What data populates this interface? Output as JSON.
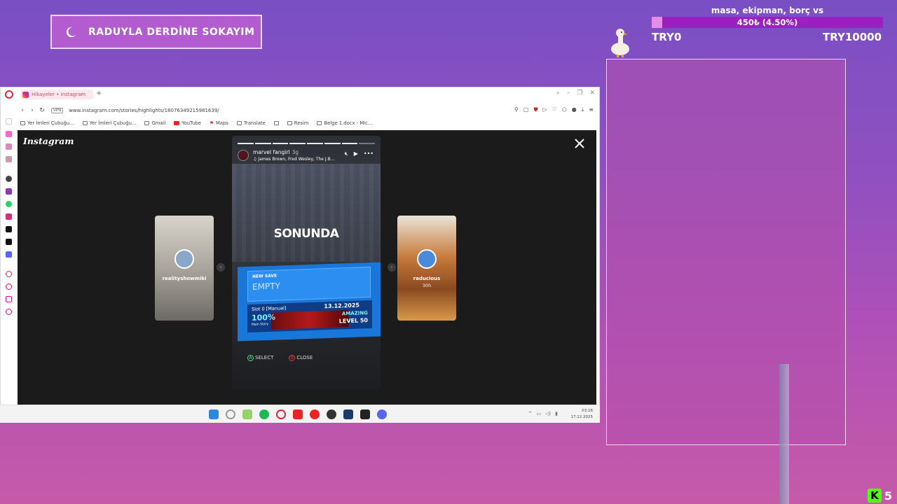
{
  "overlay": {
    "title": "RADUYLA DERDİNE SOKAYIM",
    "goal": {
      "label": "masa, ekipman, borç vs",
      "progress_text": "450₺ (4.50%)",
      "progress_fraction": 0.045,
      "min_label": "TRY0",
      "max_label": "TRY10000"
    },
    "viewer_count": "5",
    "colors": {
      "goal_bar": "#9c1fc0",
      "goal_fill": "#e58be8",
      "kick_green": "#53fc18"
    }
  },
  "browser": {
    "tab_title": "Hikayeler • Instagram",
    "vpn_label": "VPN",
    "url": "www.instagram.com/stories/highlights/18076349215981639/",
    "bookmarks": [
      "Yer İmleri Çubuğu...",
      "Yer İmleri Çubuğu...",
      "Gmail",
      "YouTube",
      "Maps",
      "Translate",
      "",
      "Resim",
      "Belge 1.docx - Mic..."
    ]
  },
  "instagram": {
    "logo": "Instagram",
    "story": {
      "username": "marvel fangirl",
      "time": "3g",
      "music": "James Brown, Fred Wesley, The J.B...",
      "overlay_text": "SONUNDA",
      "save_screen": {
        "new_save": "NEW SAVE",
        "empty": "EMPTY",
        "slot": "Slot 0 [Manual]",
        "date": "13.12.2025",
        "percent": "100%",
        "main_story": "Main Story",
        "rating": "AMAZING",
        "level": "LEVEL 50",
        "select": "SELECT",
        "close": "CLOSE"
      }
    },
    "prev_story": {
      "username": "realityshowmiki",
      "time": ""
    },
    "next_story": {
      "username": "raducious",
      "time": "30h"
    }
  },
  "taskbar": {
    "time": "03:16",
    "date": "17.12.2025"
  }
}
